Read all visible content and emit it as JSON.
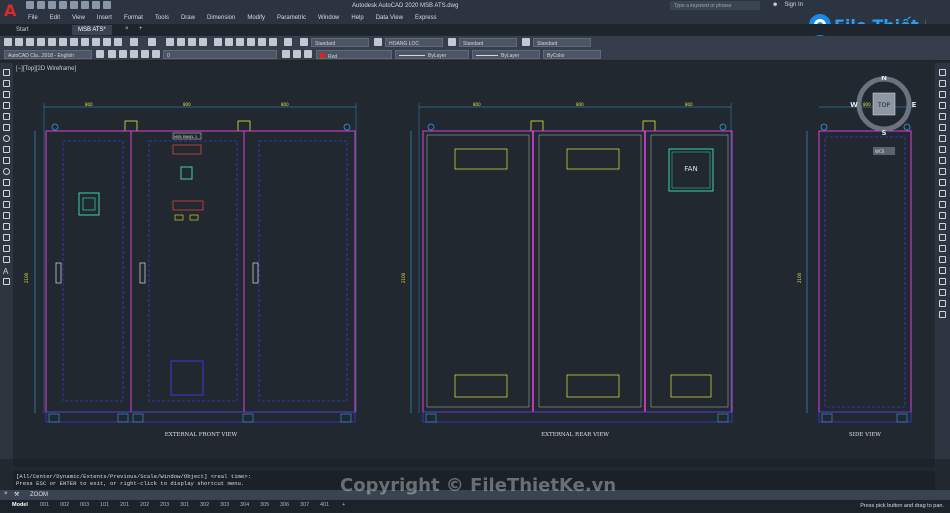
{
  "app": {
    "title": "Autodesk AutoCAD 2020   MSB ATS.dwg",
    "search_placeholder": "Type a keyword or phrase",
    "signin_label": "Sign In"
  },
  "menu": [
    "File",
    "Edit",
    "View",
    "Insert",
    "Format",
    "Tools",
    "Draw",
    "Dimension",
    "Modify",
    "Parametric",
    "Window",
    "Help",
    "Data View",
    "Express"
  ],
  "tabs": [
    {
      "label": "Start",
      "active": false
    },
    {
      "label": "MSB ATS*",
      "active": true
    }
  ],
  "toolbar": {
    "text_style": "Standard",
    "dim_style": "HOANG LOC",
    "table_style": "Standard",
    "multileader_style": "Standard",
    "workspace": "AutoCAD Cla...2018 - English",
    "layer": "0",
    "color": "Red",
    "linetype": "ByLayer",
    "lineweight": "ByLayer",
    "plotstyle": "ByColor"
  },
  "viewport": {
    "label": "[−][Top][2D Wireframe]"
  },
  "drawing": {
    "views": [
      {
        "caption": "EXTERNAL FRONT VIEW"
      },
      {
        "caption": "EXTERNAL REAR VIEW"
      },
      {
        "caption": "SIDE VIEW"
      }
    ],
    "fan_label": "FAN",
    "front_panel_label": "MSB PANEL 1",
    "dim_width": "800",
    "dim_width_side": "800",
    "dim_height": "2100",
    "side_tag": "WCS"
  },
  "viewcube": {
    "top": "TOP",
    "n": "N",
    "s": "S",
    "e": "E",
    "w": "W"
  },
  "command": {
    "history_line1": "[All/Center/Dynamic/Extents/Previous/Scale/Window/Object] <real time>:",
    "history_line2": "Press ESC or ENTER to exit, or right-click to display shortcut menu.",
    "current": "ZOOM"
  },
  "layout_tabs": [
    "Model",
    "001",
    "002",
    "003",
    "101",
    "201",
    "202",
    "203",
    "301",
    "302",
    "303",
    "304",
    "305",
    "306",
    "307",
    "401"
  ],
  "status_text": "Press pick button and drag to pan.",
  "watermark": {
    "logo_text": "File Thiết Kế.vn",
    "bottom_text": "Copyright © FileThietKe.vn"
  },
  "colors": {
    "background": "#212830",
    "cabinet_outline": "#e040e0",
    "hidden_lines": "#3a3ad6",
    "dimension": "#3aa0e0",
    "vents": "#e8e83a",
    "fan": "#3ad6a0"
  }
}
